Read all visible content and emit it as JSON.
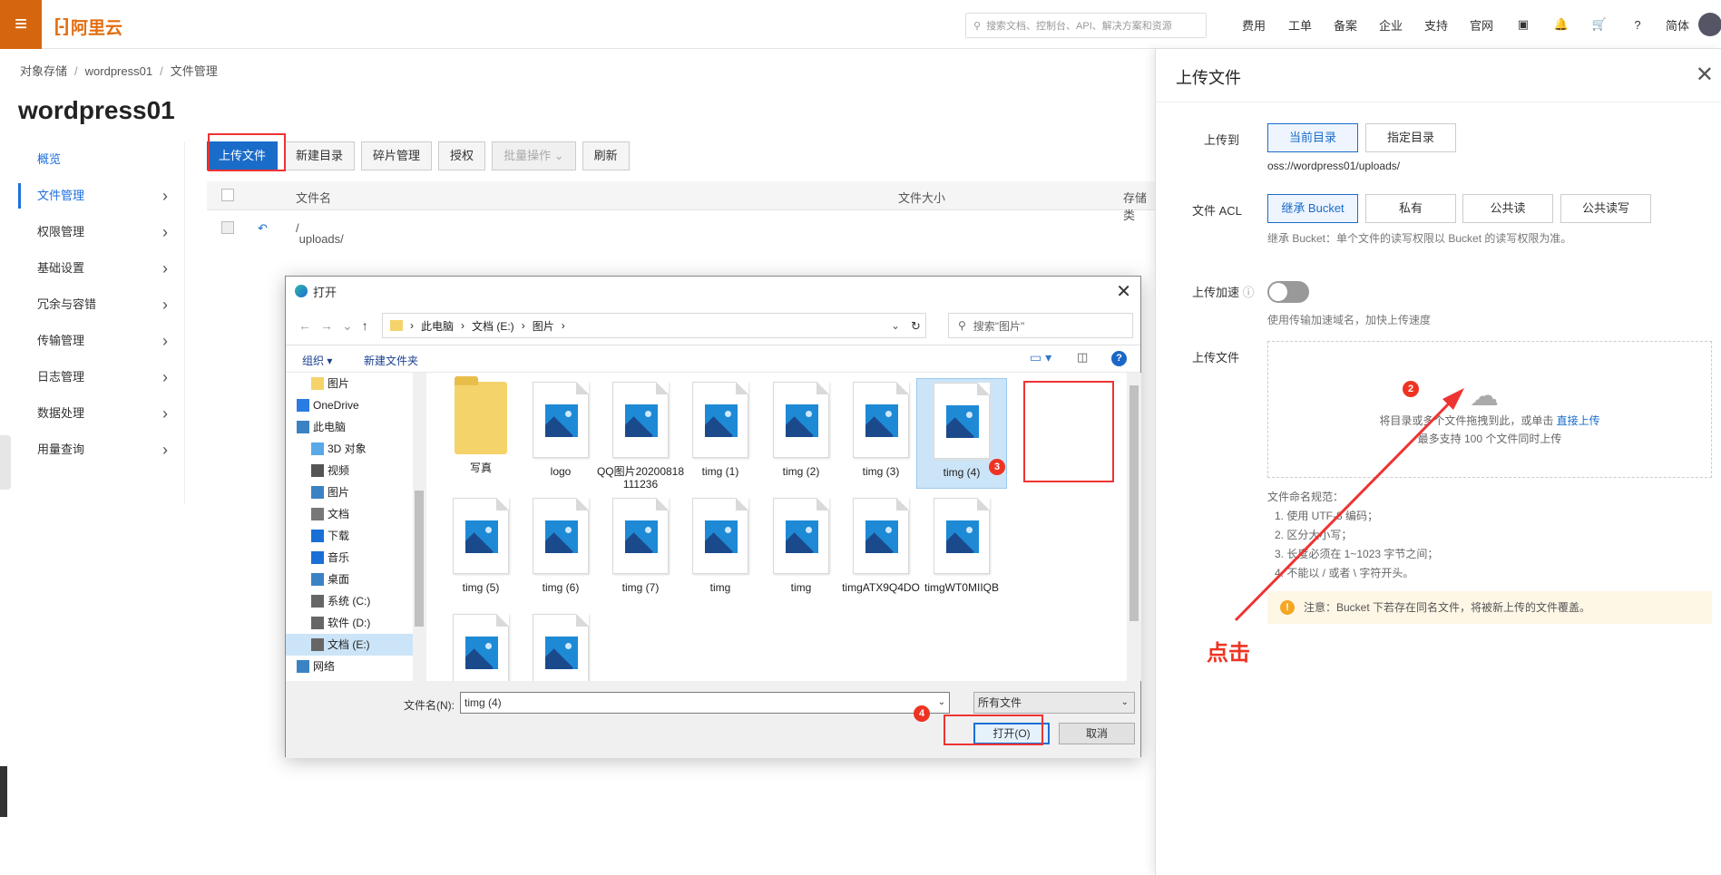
{
  "header": {
    "logo_text": "阿里云",
    "search_placeholder": "搜索文档、控制台、API、解决方案和资源",
    "nav": [
      "费用",
      "工单",
      "备案",
      "企业",
      "支持",
      "官网"
    ],
    "lang": "简体"
  },
  "breadcrumb": [
    "对象存储",
    "wordpress01",
    "文件管理"
  ],
  "page_title": "wordpress01",
  "sidebar": [
    "概览",
    "文件管理",
    "权限管理",
    "基础设置",
    "冗余与容错",
    "传输管理",
    "日志管理",
    "数据处理",
    "用量查询"
  ],
  "toolbar": {
    "upload": "上传文件",
    "newdir": "新建目录",
    "fragments": "碎片管理",
    "auth": "授权",
    "batch": "批量操作",
    "refresh": "刷新"
  },
  "table": {
    "col_name": "文件名",
    "col_size": "文件大小",
    "col_storage": "存储类",
    "row_name": "uploads/"
  },
  "dialog": {
    "title": "打开",
    "path": [
      "此电脑",
      "文档 (E:)",
      "图片"
    ],
    "search_placeholder": "搜索\"图片\"",
    "organize": "组织 ▾",
    "new_folder": "新建文件夹",
    "tree": [
      "图片",
      "OneDrive",
      "此电脑",
      "3D 对象",
      "视频",
      "图片",
      "文档",
      "下载",
      "音乐",
      "桌面",
      "系统 (C:)",
      "软件 (D:)",
      "文档 (E:)",
      "网络"
    ],
    "files": [
      {
        "name": "写真",
        "type": "folder"
      },
      {
        "name": "logo",
        "type": "image"
      },
      {
        "name": "QQ图片20200818111236",
        "type": "image"
      },
      {
        "name": "timg (1)",
        "type": "image"
      },
      {
        "name": "timg (2)",
        "type": "image"
      },
      {
        "name": "timg (3)",
        "type": "image"
      },
      {
        "name": "timg (4)",
        "type": "image"
      },
      {
        "name": "timg (5)",
        "type": "image"
      },
      {
        "name": "timg (6)",
        "type": "image"
      },
      {
        "name": "timg (7)",
        "type": "image"
      },
      {
        "name": "timg",
        "type": "image"
      },
      {
        "name": "timg",
        "type": "image"
      },
      {
        "name": "timgATX9Q4DO",
        "type": "image"
      },
      {
        "name": "timgWT0MIIQB",
        "type": "image"
      },
      {
        "name": "",
        "type": "image"
      },
      {
        "name": "",
        "type": "image"
      }
    ],
    "filename_label": "文件名(N):",
    "filename_value": "timg (4)",
    "filetype": "所有文件",
    "open": "打开(O)",
    "cancel": "取消"
  },
  "panel": {
    "title": "上传文件",
    "upload_to_label": "上传到",
    "upload_to_options": [
      "当前目录",
      "指定目录"
    ],
    "upload_path": "oss://wordpress01/uploads/",
    "acl_label": "文件 ACL",
    "acl_options": [
      "继承 Bucket",
      "私有",
      "公共读",
      "公共读写"
    ],
    "acl_note": "继承 Bucket：单个文件的读写权限以 Bucket 的读写权限为准。",
    "accel_label": "上传加速",
    "accel_note": "使用传输加速域名，加快上传速度",
    "file_label": "上传文件",
    "drop_text": "将目录或多个文件拖拽到此，或单击",
    "drop_link": "直接上传",
    "drop_note": "最多支持 100 个文件同时上传",
    "rules_title": "文件命名规范：",
    "rules": [
      "1. 使用 UTF-8 编码；",
      "2. 区分大小写；",
      "3. 长度必须在 1~1023 字节之间；",
      "4. 不能以 / 或者 \\ 字符开头。"
    ],
    "warning": "注意：Bucket 下若存在同名文件，将被新上传的文件覆盖。"
  },
  "annotations": {
    "click_text": "点击",
    "markers": [
      "1",
      "2",
      "3",
      "4"
    ]
  }
}
